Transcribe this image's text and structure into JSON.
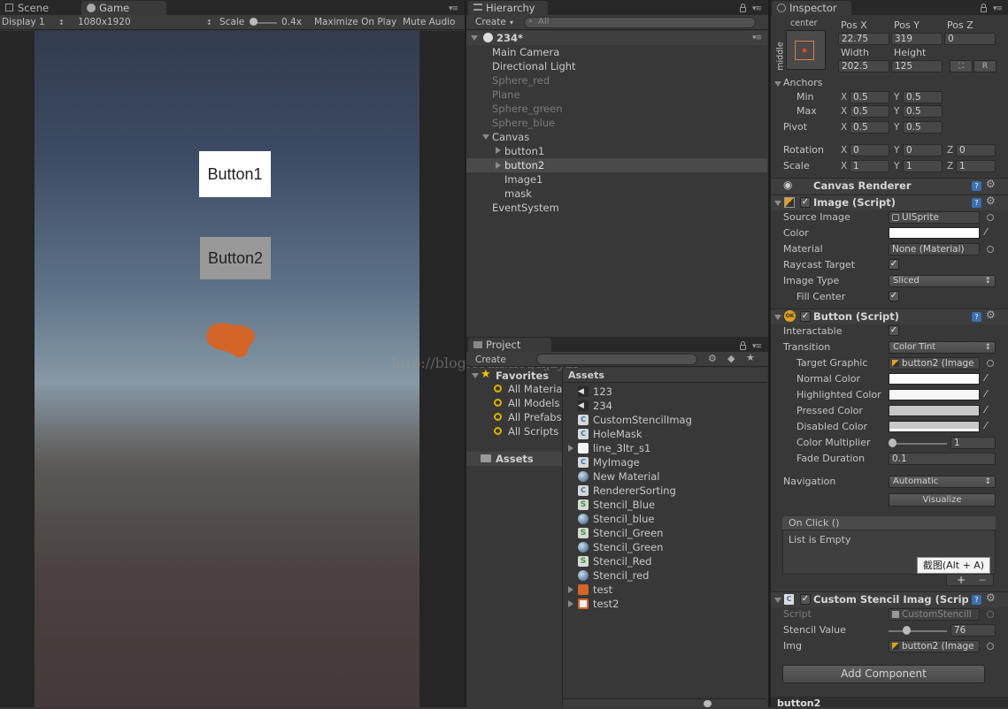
{
  "game_panel": {
    "tabs": [
      {
        "label": "Scene"
      },
      {
        "label": "Game"
      }
    ],
    "display": "Display 1",
    "resolution": "1080x1920",
    "scale_label": "Scale",
    "scale_value": "0.4x",
    "maximize": "Maximize On Play",
    "mute": "Mute Audio",
    "buttons": [
      {
        "label": "Button1",
        "bg": "#ffffff"
      },
      {
        "label": "Button2",
        "bg": "#999999"
      }
    ],
    "watermark": "http://blog.csdn.net/hjzyzr"
  },
  "hierarchy": {
    "tab": "Hierarchy",
    "create": "Create",
    "search_placeholder": "All",
    "scene": "234*",
    "items": [
      {
        "label": "Main Camera"
      },
      {
        "label": "Directional Light"
      },
      {
        "label": "Sphere_red"
      },
      {
        "label": "Plane"
      },
      {
        "label": "Sphere_green"
      },
      {
        "label": "Sphere_blue"
      },
      {
        "label": "Canvas"
      },
      {
        "label": "button1"
      },
      {
        "label": "button2"
      },
      {
        "label": "Image1"
      },
      {
        "label": "mask"
      },
      {
        "label": "EventSystem"
      }
    ]
  },
  "project": {
    "tab": "Project",
    "create": "Create",
    "favorites_title": "Favorites",
    "favorites": [
      {
        "label": "All Materia"
      },
      {
        "label": "All Models"
      },
      {
        "label": "All Prefabs"
      },
      {
        "label": "All Scripts"
      }
    ],
    "assets_root": "Assets",
    "assets_header": "Assets",
    "assets": [
      {
        "label": "123",
        "icon": "unity-scene"
      },
      {
        "label": "234",
        "icon": "unity-scene"
      },
      {
        "label": "CustomStencilImag",
        "icon": "cs-script"
      },
      {
        "label": "HoleMask",
        "icon": "cs-script"
      },
      {
        "label": "line_3ltr_s1",
        "icon": "texture"
      },
      {
        "label": "MyImage",
        "icon": "cs-script"
      },
      {
        "label": "New Material",
        "icon": "material"
      },
      {
        "label": "RendererSorting",
        "icon": "cs-script"
      },
      {
        "label": "Stencil_Blue",
        "icon": "shader"
      },
      {
        "label": "Stencil_blue",
        "icon": "material"
      },
      {
        "label": "Stencil_Green",
        "icon": "shader"
      },
      {
        "label": "Stencil_Green",
        "icon": "material"
      },
      {
        "label": "Stencil_Red",
        "icon": "shader"
      },
      {
        "label": "Stencil_red",
        "icon": "material"
      },
      {
        "label": "test",
        "icon": "prefab-orange"
      },
      {
        "label": "test2",
        "icon": "prefab-white"
      }
    ]
  },
  "inspector": {
    "tab": "Inspector",
    "rect": {
      "anchor_h": "center",
      "anchor_v": "middle",
      "posx_label": "Pos X",
      "posy_label": "Pos Y",
      "posz_label": "Pos Z",
      "posx": "22.75",
      "posy": "319",
      "posz": "0",
      "width_label": "Width",
      "height_label": "Height",
      "width": "202.5",
      "height": "125",
      "r_btn": "R"
    },
    "anchors": {
      "title": "Anchors",
      "min_label": "Min",
      "max_label": "Max",
      "minx": "0.5",
      "miny": "0.5",
      "maxx": "0.5",
      "maxy": "0.5"
    },
    "pivot": {
      "label": "Pivot",
      "x": "0.5",
      "y": "0.5"
    },
    "rotation": {
      "label": "Rotation",
      "x": "0",
      "y": "0",
      "z": "0"
    },
    "scale": {
      "label": "Scale",
      "x": "1",
      "y": "1",
      "z": "1"
    },
    "axes": {
      "x": "X",
      "y": "Y",
      "z": "Z"
    },
    "canvas_renderer": "Canvas Renderer",
    "image": {
      "title": "Image (Script)",
      "source_label": "Source Image",
      "source": "UISprite",
      "color_label": "Color",
      "material_label": "Material",
      "material": "None (Material)",
      "raycast_label": "Raycast Target",
      "type_label": "Image Type",
      "type": "Sliced",
      "fill_label": "Fill Center"
    },
    "button": {
      "title": "Button (Script)",
      "interactable_label": "Interactable",
      "transition_label": "Transition",
      "transition": "Color Tint",
      "target_label": "Target Graphic",
      "target": "button2 (Image",
      "normal_label": "Normal Color",
      "highlighted_label": "Highlighted Color",
      "pressed_label": "Pressed Color",
      "disabled_label": "Disabled Color",
      "multiplier_label": "Color Multiplier",
      "multiplier": "1",
      "multiplier_level": 0.2,
      "fade_label": "Fade Duration",
      "fade": "0.1",
      "navigation_label": "Navigation",
      "navigation": "Automatic",
      "visualize": "Visualize"
    },
    "onclick": {
      "title": "On Click ()",
      "empty": "List is Empty",
      "tooltip": "截图(Alt + A)",
      "plus": "+",
      "minus": "−"
    },
    "custom": {
      "title": "Custom Stencil Imag (Scrip",
      "script_label": "Script",
      "script": "CustomStencilI",
      "stencil_label": "Stencil Value",
      "stencil": "76",
      "stencil_level": 0.3,
      "img_label": "Img",
      "img": "button2 (Image"
    },
    "add_component": "Add Component",
    "footer": "button2"
  }
}
